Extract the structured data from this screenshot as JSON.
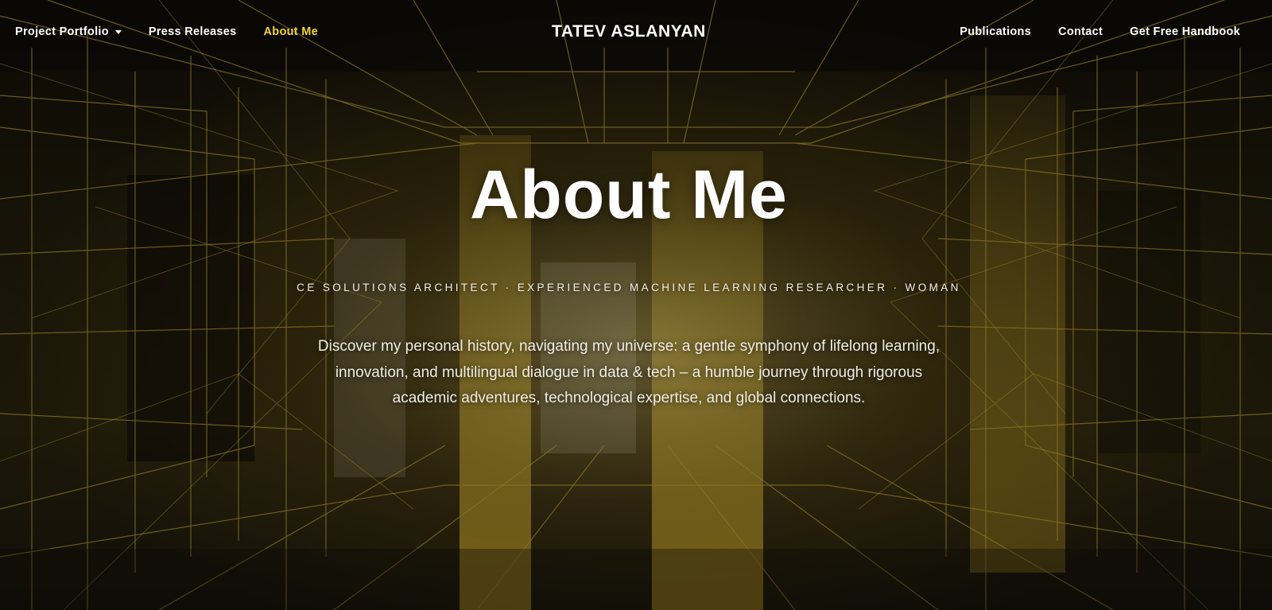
{
  "nav": {
    "left": [
      {
        "label": "Project Portfolio",
        "has_dropdown": true
      },
      {
        "label": "Press Releases"
      },
      {
        "label": "About Me",
        "active": true
      }
    ],
    "brand": "TATEV ASLANYAN",
    "right": [
      {
        "label": "Publications"
      },
      {
        "label": "Contact"
      },
      {
        "label": "Get Free Handbook"
      }
    ]
  },
  "hero": {
    "title": "About Me",
    "subtitle": "CE SOLUTIONS ARCHITECT · EXPERIENCED MACHINE LEARNING RESEARCHER · WOMAN",
    "intro": "Discover my personal history, navigating my universe: a gentle symphony of lifelong learning, innovation, and multilingual dialogue in data & tech – a humble journey through rigorous academic adventures, technological expertise, and global connections."
  },
  "colors": {
    "accent": "#f3d436",
    "text": "#ffffff",
    "background": "#0b0905",
    "wireframe": "#8a7424"
  },
  "icons": {
    "dropdown": "caret-down-icon"
  }
}
